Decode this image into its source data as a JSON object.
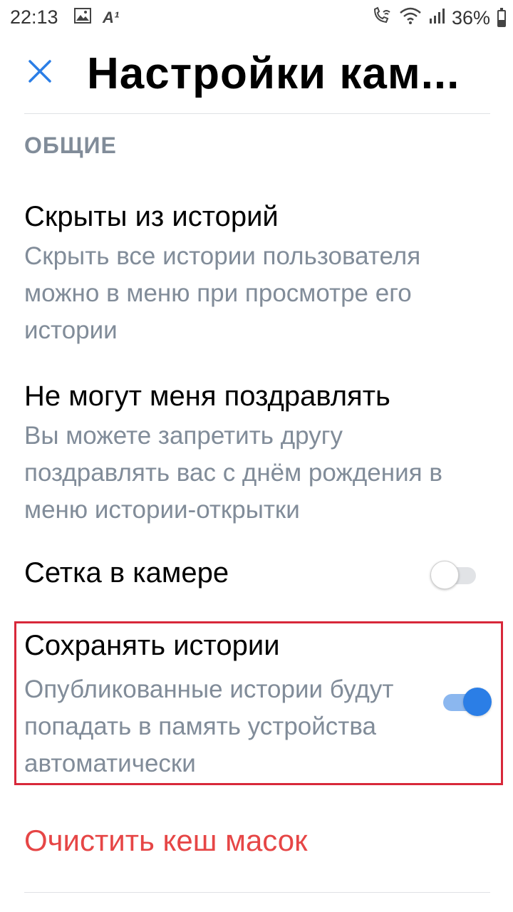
{
  "status_bar": {
    "time": "22:13",
    "image_icon": "image-icon",
    "a1_icon": "A¹",
    "wifi_call_icon": "wifi-call-icon",
    "wifi_icon": "wifi-icon",
    "signal_icon": "signal-icon",
    "battery": "36%"
  },
  "header": {
    "title": "Настройки кам...",
    "close_icon": "close-icon"
  },
  "section": {
    "label": "ОБЩИЕ"
  },
  "items": [
    {
      "title": "Скрыты из историй",
      "subtitle": "Скрыть все истории пользователя можно в меню при просмотре его истории"
    },
    {
      "title": "Не могут меня поздравлять",
      "subtitle": "Вы можете запретить другу поздравлять вас с днём рождения в меню истории-открытки"
    },
    {
      "title": "Сетка в камере",
      "toggle": false
    },
    {
      "title": "Сохранять истории",
      "subtitle": "Опубликованные истории будут попадать в память устройства автоматически",
      "toggle": true
    }
  ],
  "danger_action": {
    "label": "Очистить кеш масок",
    "color": "#e64646"
  },
  "colors": {
    "accent": "#2b7ee6",
    "secondary_text": "#818c99",
    "highlight": "#d8283a"
  }
}
